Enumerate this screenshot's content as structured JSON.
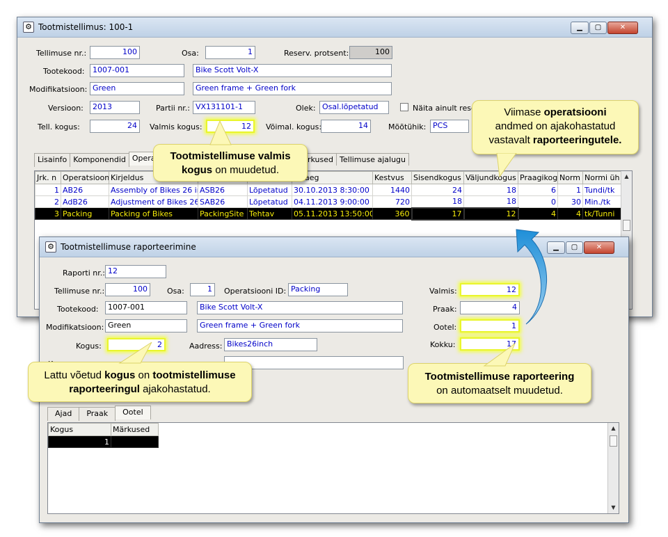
{
  "main_window": {
    "title": "Tootmistellimus: 100-1",
    "labels": {
      "order_nr": "Tellimuse nr.:",
      "part": "Osa:",
      "reserve_pct": "Reserv. protsent:",
      "product_code": "Tootekood:",
      "modification": "Modifikatsioon:",
      "version": "Versioon:",
      "batch_nr": "Partii nr.:",
      "state": "Olek:",
      "show_reserved": "Näita ainult reserv",
      "order_qty": "Tell. kogus:",
      "done_qty": "Valmis kogus:",
      "possible_qty": "Võimal. kogus:",
      "unit": "Mõõtühik:"
    },
    "values": {
      "order_nr": "100",
      "part": "1",
      "reserve_pct": "100",
      "product_code": "1007-001",
      "product_name": "Bike Scott Volt-X",
      "modification": "Green",
      "modification_desc": "Green frame + Green fork",
      "version": "2013",
      "batch_nr": "VX131101-1",
      "state": "Osal.lõpetatud",
      "order_qty": "24",
      "done_qty": "12",
      "possible_qty": "14",
      "unit": "PCS"
    },
    "tabs": [
      "Lisainfo",
      "Komponendid",
      "Opera",
      "rkused",
      "Tellimuse ajalugu"
    ],
    "columns": [
      "Jrk. n",
      "Operatsiooni",
      "Kirjeldus",
      "",
      "",
      "se aeg",
      "Kestvus",
      "Sisendkogus",
      "Väljundkogus",
      "Praagikog",
      "Norm",
      "Normi üh"
    ],
    "rows": [
      {
        "nr": "1",
        "op": "AB26",
        "desc": "Assembly of Bikes 26 in",
        "site": "ASB26",
        "state": "Lõpetatud",
        "time": "30.10.2013 8:30:00",
        "dur": "1440",
        "in": "24",
        "out": "18",
        "scrap": "6",
        "norm": "1",
        "unit": "Tundi/tk"
      },
      {
        "nr": "2",
        "op": "AdB26",
        "desc": "Adjustment of Bikes 26",
        "site": "SAB26",
        "state": "Lõpetatud",
        "time": "04.11.2013 9:00:00",
        "dur": "720",
        "in": "18",
        "out": "18",
        "scrap": "0",
        "norm": "30",
        "unit": "Min./tk"
      },
      {
        "nr": "3",
        "op": "Packing",
        "desc": "Packing of Bikes",
        "site": "PackingSite",
        "state": "Tehtav",
        "time": "05.11.2013 13:50:00",
        "dur": "360",
        "in": "17",
        "out": "12",
        "scrap": "4",
        "norm": "4",
        "unit": "tk/Tunni"
      }
    ]
  },
  "report_window": {
    "title": "Tootmistellimuse raporteerimine",
    "labels": {
      "report_nr": "Raporti nr.:",
      "order_nr": "Tellimuse nr.:",
      "part": "Osa:",
      "op_id": "Operatsiooni ID:",
      "product_code": "Tootekood:",
      "modification": "Modifikatsioon:",
      "qty": "Kogus:",
      "address": "Aadress:",
      "done": "Valmis:",
      "scrap": "Praak:",
      "waiting": "Ootel:",
      "total": "Kokku:",
      "partial": "Kom"
    },
    "values": {
      "report_nr": "12",
      "order_nr": "100",
      "part": "1",
      "op_id": "Packing",
      "product_code": "1007-001",
      "product_name": "Bike Scott Volt-X",
      "modification": "Green",
      "modification_desc": "Green frame + Green fork",
      "qty": "2",
      "address": "Bikes26inch",
      "done": "12",
      "scrap": "4",
      "waiting": "1",
      "total": "17"
    },
    "tabs": [
      "Ajad",
      "Praak",
      "Ootel"
    ],
    "columns": [
      "Kogus",
      "Märkused"
    ],
    "rows": [
      {
        "qty": "1",
        "note": ""
      }
    ]
  },
  "callouts": {
    "top_right": [
      "Viimase ",
      "operatsiooni",
      "andmed on ajakohastatud",
      "vastavalt ",
      "raporteeringutele."
    ],
    "middle": [
      "Tootmistellimuse valmis",
      "kogus",
      " on muudetud."
    ],
    "bottom_left": [
      "Lattu võetud ",
      "kogus",
      " on ",
      "tootmistellimuse",
      "raporteeringul",
      " ajakohastatud."
    ],
    "bottom_right": [
      "Tootmistellimuse raporteering",
      "on automaatselt muudetud."
    ]
  },
  "colors": {
    "field_text": "#0000c8",
    "highlight": "#e9f52c",
    "selected_row_text": "#f6ec0a",
    "callout_bg": "#fcf8b7"
  },
  "icons": [
    "app-icon",
    "minimize-icon",
    "maximize-icon",
    "close-icon",
    "checkbox-icon",
    "scroll-up-icon",
    "scroll-down-icon",
    "curved-arrow-icon"
  ]
}
